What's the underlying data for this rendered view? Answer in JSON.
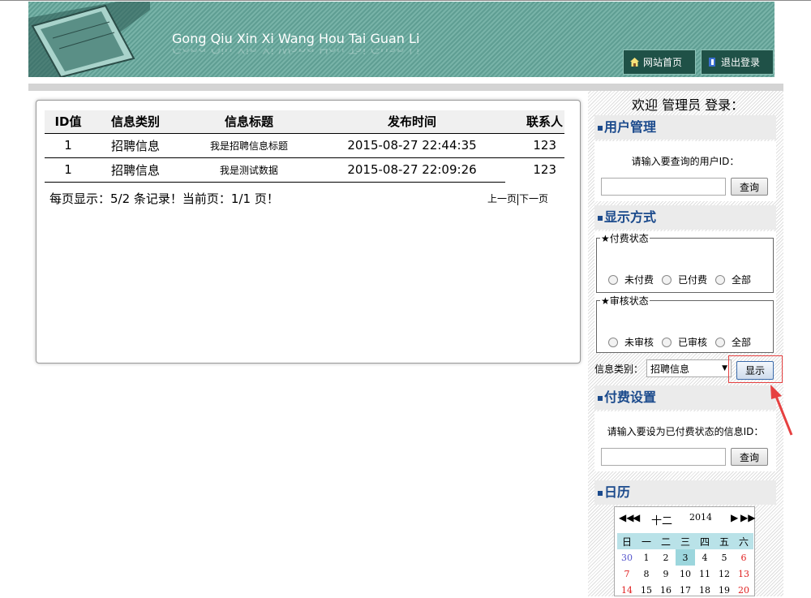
{
  "header": {
    "title": "Gong Qiu Xin Xi Wang Hou Tai Guan Li",
    "home_label": "网站首页",
    "logout_label": "退出登录"
  },
  "table": {
    "columns": [
      "ID值",
      "信息类别",
      "信息标题",
      "发布时间",
      "联系人"
    ],
    "rows": [
      [
        "1",
        "招聘信息",
        "我是招聘信息标题",
        "2015-08-27 22:44:35",
        "123"
      ],
      [
        "1",
        "招聘信息",
        "我是测试数据",
        "2015-08-27 22:09:26",
        "123"
      ]
    ]
  },
  "pager": {
    "summary": "每页显示：5/2 条记录！当前页：1/1 页！",
    "prev": "上一页",
    "next": "下一页"
  },
  "sidebar": {
    "welcome": "欢迎 管理员 登录：",
    "user_mgmt": {
      "title": "用户管理",
      "prompt": "请输入要查询的用户ID：",
      "button": "查询"
    },
    "display": {
      "title": "显示方式",
      "pay_legend": "★付费状态",
      "pay_options": [
        "未付费",
        "已付费",
        "全部"
      ],
      "audit_legend": "★审核状态",
      "audit_options": [
        "未审核",
        "已审核",
        "全部"
      ],
      "category_label": "信息类别：",
      "category_value": "招聘信息",
      "show_button": "显示"
    },
    "pay_setting": {
      "title": "付费设置",
      "prompt": "请输入要设为已付费状态的信息ID：",
      "button": "查询"
    },
    "calendar": {
      "title": "日历",
      "month": "十二",
      "year": "2014",
      "weekdays": [
        "日",
        "一",
        "二",
        "三",
        "四",
        "五",
        "六"
      ],
      "weeks": [
        [
          "30",
          "1",
          "2",
          "3",
          "4",
          "5",
          "6"
        ],
        [
          "7",
          "8",
          "9",
          "10",
          "11",
          "12",
          "13"
        ],
        [
          "14",
          "15",
          "16",
          "17",
          "18",
          "19",
          "20"
        ]
      ],
      "today": "3"
    }
  },
  "colors": {
    "banner": "#6aa89c",
    "section_title": "#1b4a8c",
    "highlight": "#e64040"
  }
}
